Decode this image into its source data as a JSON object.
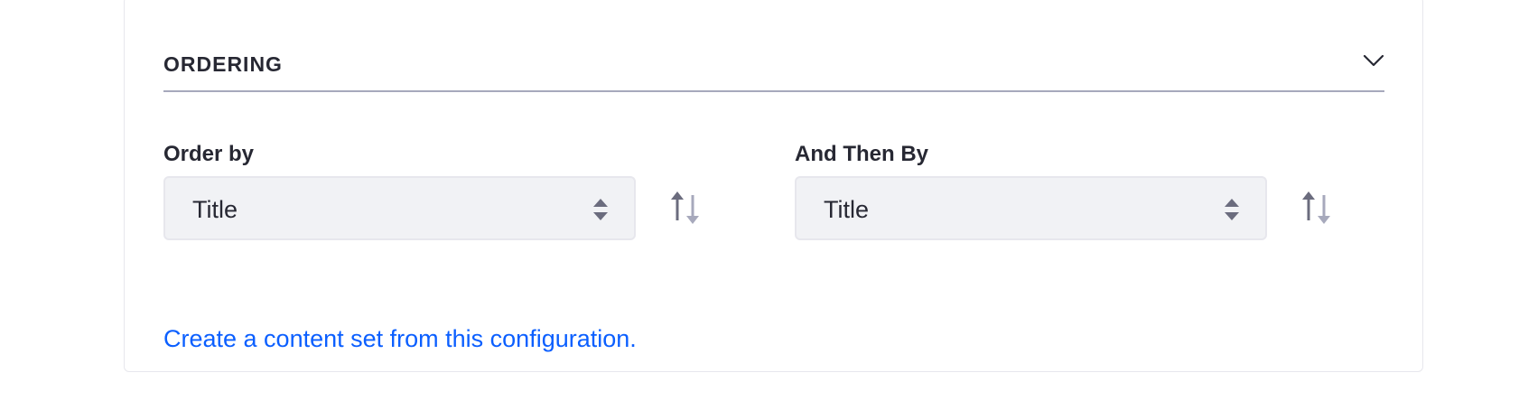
{
  "section": {
    "title": "ORDERING"
  },
  "order_by": {
    "label": "Order by",
    "selected": "Title"
  },
  "then_by": {
    "label": "And Then By",
    "selected": "Title"
  },
  "link_text": "Create a content set from this configuration.",
  "colors": {
    "link": "#0b5fff",
    "select_bg": "#f1f2f5",
    "divider": "#a7a9bc",
    "icon": "#6b6c7e"
  }
}
